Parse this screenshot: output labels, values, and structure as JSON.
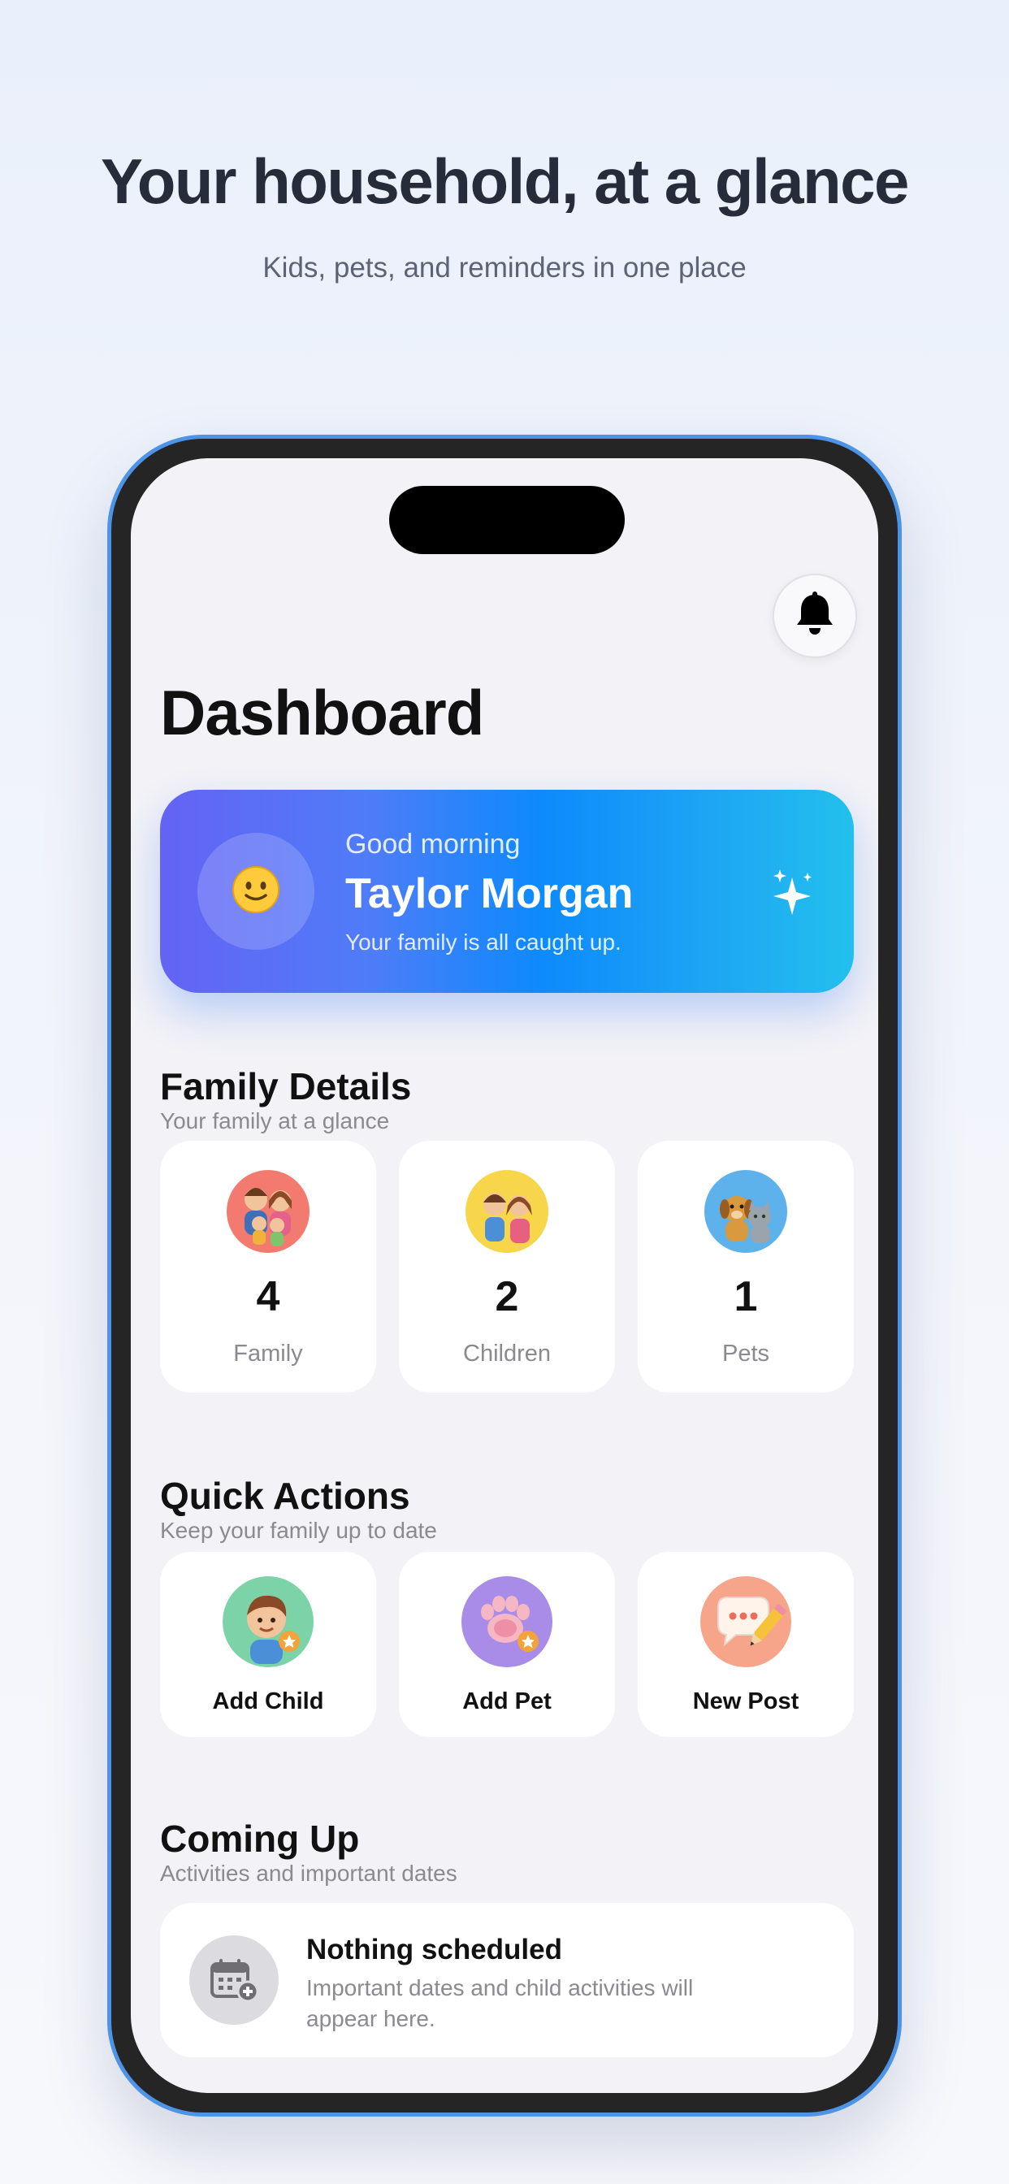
{
  "hero": {
    "title": "Your household, at a glance",
    "subtitle": "Kids, pets, and reminders in one place"
  },
  "app": {
    "page_title": "Dashboard",
    "greeting": {
      "hello": "Good morning",
      "name": "Taylor Morgan",
      "status": "Your family is all caught up."
    },
    "family_details": {
      "title": "Family Details",
      "subtitle": "Your family at a glance",
      "stats": [
        {
          "value": "4",
          "label": "Family",
          "icon": "family-icon"
        },
        {
          "value": "2",
          "label": "Children",
          "icon": "children-icon"
        },
        {
          "value": "1",
          "label": "Pets",
          "icon": "pets-icon"
        }
      ]
    },
    "quick_actions": {
      "title": "Quick Actions",
      "subtitle": "Keep your family up to date",
      "items": [
        {
          "label": "Add Child",
          "icon": "add-child-icon"
        },
        {
          "label": "Add Pet",
          "icon": "add-pet-icon"
        },
        {
          "label": "New Post",
          "icon": "new-post-icon"
        }
      ]
    },
    "coming_up": {
      "title": "Coming Up",
      "subtitle": "Activities and important dates",
      "empty_title": "Nothing scheduled",
      "empty_desc": "Important dates and child activities will appear here."
    }
  },
  "colors": {
    "background": "#eaf0fb",
    "phone_frame": "#252525",
    "phone_outline": "#4d93e6",
    "screen_bg": "#f2f2f7",
    "greeting_gradient_start": "#6463f4",
    "greeting_gradient_end": "#22c0ec"
  }
}
